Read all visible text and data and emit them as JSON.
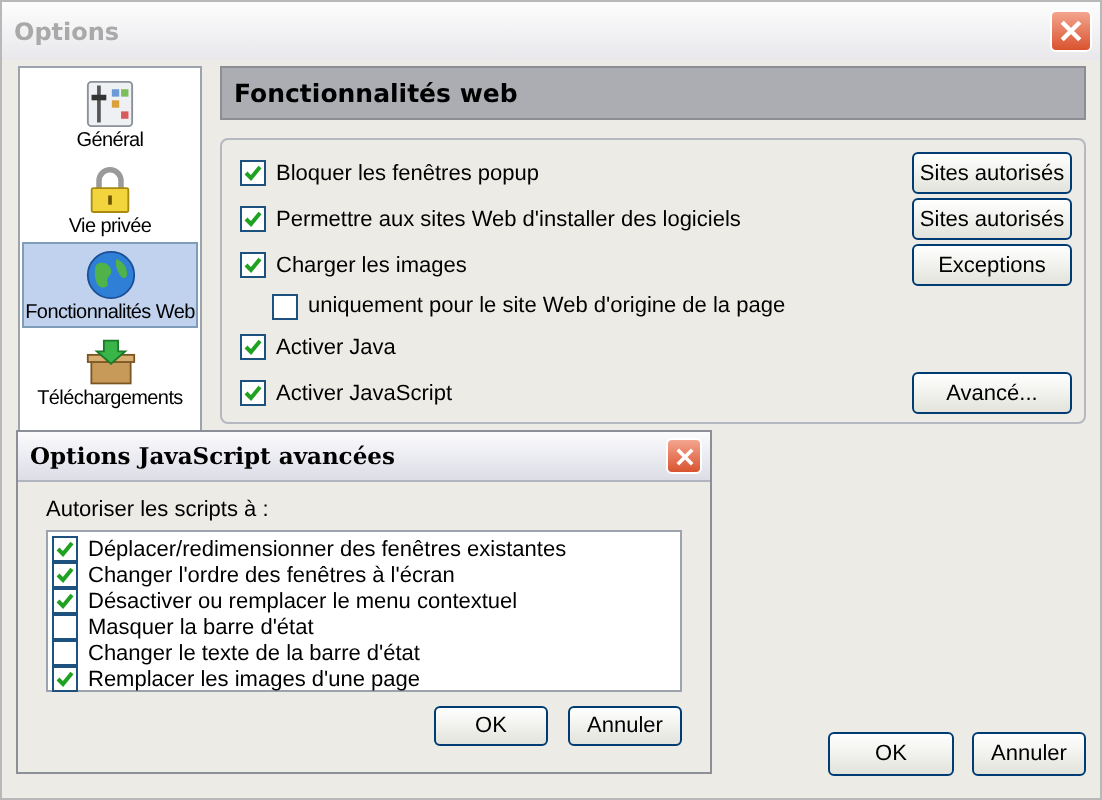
{
  "window": {
    "title": "Options"
  },
  "sidebar": {
    "items": [
      {
        "label": "Général",
        "selected": false
      },
      {
        "label": "Vie privée",
        "selected": false
      },
      {
        "label": "Fonctionnalités Web",
        "selected": true
      },
      {
        "label": "Téléchargements",
        "selected": false
      }
    ]
  },
  "panel": {
    "title": "Fonctionnalités web",
    "options": [
      {
        "label": "Bloquer les fenêtres popup",
        "checked": true,
        "indent": false,
        "button": "Sites autorisés"
      },
      {
        "label": "Permettre aux sites Web d'installer des logiciels",
        "checked": true,
        "indent": false,
        "button": "Sites autorisés"
      },
      {
        "label": "Charger les images",
        "checked": true,
        "indent": false,
        "button": "Exceptions"
      },
      {
        "label": "uniquement pour le site Web d'origine de la page",
        "checked": false,
        "indent": true
      },
      {
        "label": "Activer Java",
        "checked": true,
        "indent": false
      },
      {
        "label": "Activer JavaScript",
        "checked": true,
        "indent": false,
        "button": "Avancé..."
      }
    ]
  },
  "buttons": [
    "OK",
    "Annuler"
  ],
  "dialog": {
    "title": "Options JavaScript avancées",
    "prompt": "Autoriser les scripts à :",
    "options": [
      {
        "label": "Déplacer/redimensionner des fenêtres existantes",
        "checked": true
      },
      {
        "label": "Changer l'ordre des fenêtres à l'écran",
        "checked": true
      },
      {
        "label": "Désactiver ou remplacer le menu contextuel",
        "checked": true
      },
      {
        "label": "Masquer la barre d'état",
        "checked": false
      },
      {
        "label": "Changer le texte de la barre d'état",
        "checked": false
      },
      {
        "label": "Remplacer les images d'une page",
        "checked": true
      }
    ],
    "buttons": [
      "OK",
      "Annuler"
    ]
  }
}
